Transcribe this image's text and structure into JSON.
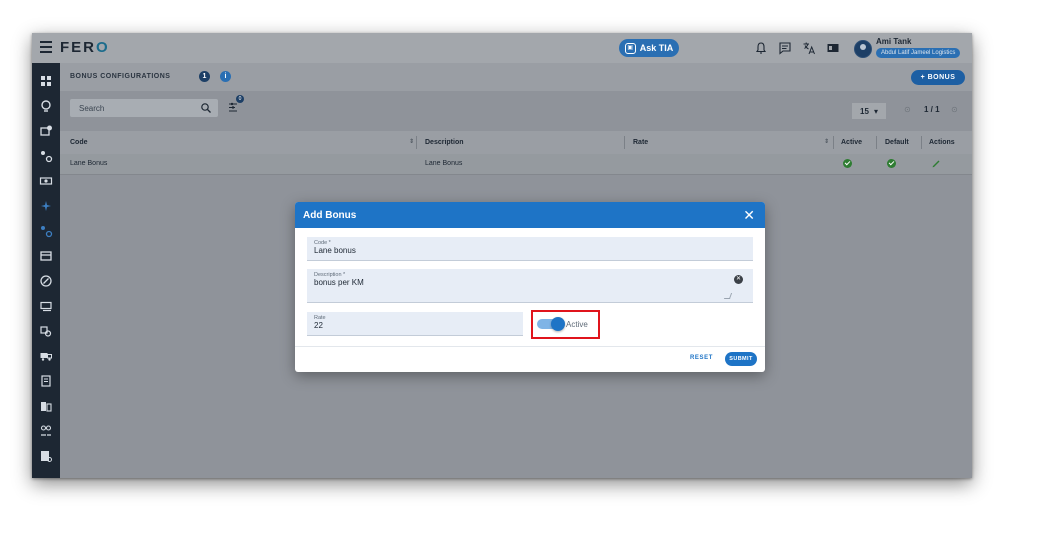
{
  "app": {
    "logo_main": "FER",
    "logo_accent": "O"
  },
  "topbar": {
    "ask_label": "Ask TIA",
    "ask_icon": "tia-icon",
    "icons": [
      "bell-icon",
      "chat-icon",
      "translate-icon",
      "id-card-icon"
    ],
    "user_name": "Ami Tank",
    "user_org": "Abdul Latif Jameel Logistics"
  },
  "sidebar": {
    "items": [
      "dashboard-icon",
      "route-icon",
      "bonus-icon",
      "config-icon",
      "cash-icon",
      "sparkle-icon",
      "settings-icon",
      "card-icon",
      "circle-check-icon",
      "money-icon",
      "truck-icon",
      "delivery-icon",
      "document-icon",
      "building-icon",
      "people-icon",
      "report-icon"
    ]
  },
  "subheader": {
    "title": "BONUS CONFIGURATIONS",
    "count": "1",
    "info_glyph": "i",
    "add_label": "+ BONUS"
  },
  "toolbar": {
    "search_placeholder": "Search",
    "filter_badge": "0",
    "page_size": "15",
    "page_size_caret": "▾",
    "pager_text": "1 / 1",
    "pager_prev": "⊙",
    "pager_next": "⊙"
  },
  "table": {
    "headers": {
      "code": "Code",
      "description": "Description",
      "rate": "Rate",
      "active": "Active",
      "default": "Default",
      "actions": "Actions"
    },
    "rows": [
      {
        "code": "Lane Bonus",
        "description": "Lane Bonus",
        "rate": "",
        "active": true,
        "default": true
      }
    ]
  },
  "dialog": {
    "title": "Add Bonus",
    "close_glyph": "✕",
    "code_label": "Code *",
    "code_value": "Lane bonus",
    "description_label": "Description *",
    "description_value": "bonus per KM",
    "rate_label": "Rate",
    "rate_value": "22",
    "active_label": "Active",
    "active_on": true,
    "reset_label": "RESET",
    "submit_label": "SUBMIT"
  },
  "colors": {
    "primary": "#1e74c6",
    "sidebar": "#1d2733",
    "highlight": "#e0141c",
    "success": "#2e7d32"
  }
}
